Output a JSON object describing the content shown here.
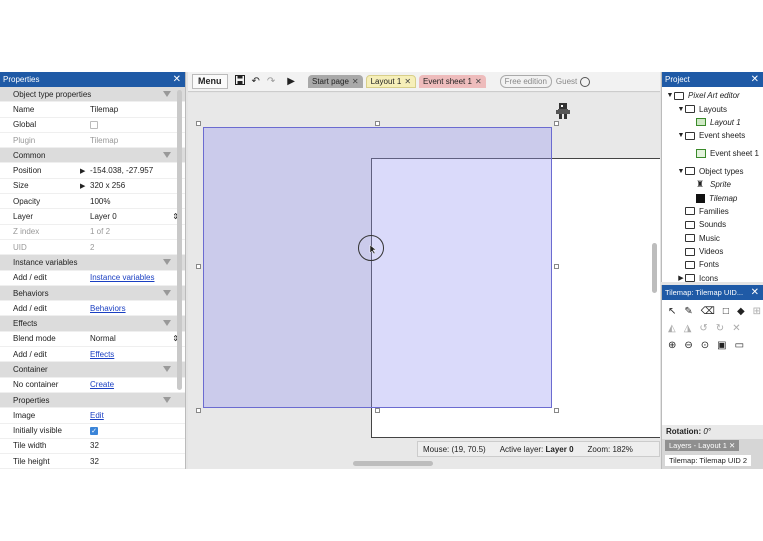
{
  "properties": {
    "title": "Properties",
    "rows": [
      {
        "type": "section",
        "label": "Object type properties"
      },
      {
        "type": "row",
        "key": "Name",
        "value": "Tilemap"
      },
      {
        "type": "check",
        "key": "Global",
        "checked": false
      },
      {
        "type": "row",
        "key": "Plugin",
        "value": "Tilemap",
        "dim": true
      },
      {
        "type": "section",
        "label": "Common"
      },
      {
        "type": "row",
        "key": "Position",
        "value": "-154.038, -27.957",
        "arrow": true
      },
      {
        "type": "row",
        "key": "Size",
        "value": "320 x 256",
        "arrow": true
      },
      {
        "type": "row",
        "key": "Opacity",
        "value": "100%"
      },
      {
        "type": "select",
        "key": "Layer",
        "value": "Layer 0"
      },
      {
        "type": "row",
        "key": "Z index",
        "value": "1 of 2",
        "dim": true
      },
      {
        "type": "row",
        "key": "UID",
        "value": "2",
        "dim": true
      },
      {
        "type": "section",
        "label": "Instance variables"
      },
      {
        "type": "link",
        "key": "Add / edit",
        "value": "Instance variables"
      },
      {
        "type": "section",
        "label": "Behaviors"
      },
      {
        "type": "link",
        "key": "Add / edit",
        "value": "Behaviors"
      },
      {
        "type": "section",
        "label": "Effects"
      },
      {
        "type": "select",
        "key": "Blend mode",
        "value": "Normal"
      },
      {
        "type": "link",
        "key": "Add / edit",
        "value": "Effects"
      },
      {
        "type": "section",
        "label": "Container"
      },
      {
        "type": "link",
        "key": "No container",
        "value": "Create"
      },
      {
        "type": "section",
        "label": "Properties"
      },
      {
        "type": "link",
        "key": "Image",
        "value": "Edit"
      },
      {
        "type": "check",
        "key": "Initially visible",
        "checked": true
      },
      {
        "type": "row",
        "key": "Tile width",
        "value": "32"
      },
      {
        "type": "row",
        "key": "Tile height",
        "value": "32"
      }
    ]
  },
  "toolbar": {
    "menu_label": "Menu",
    "tabs": [
      {
        "label": "Start page",
        "kind": "start"
      },
      {
        "label": "Layout 1",
        "kind": "layout"
      },
      {
        "label": "Event sheet 1",
        "kind": "event"
      }
    ],
    "free_label": "Free edition",
    "guest_label": "Guest"
  },
  "status": {
    "mouse": "Mouse: (19, 70.5)",
    "active_layer_prefix": "Active layer:",
    "active_layer": "Layer 0",
    "zoom": "Zoom: 182%"
  },
  "project": {
    "title": "Project",
    "items": [
      {
        "indent": 0,
        "caret": "▼",
        "icon": "folder",
        "label": "Pixel Art editor",
        "italic": true
      },
      {
        "indent": 1,
        "caret": "▼",
        "icon": "folder",
        "label": "Layouts"
      },
      {
        "indent": 2,
        "caret": "",
        "icon": "layout",
        "label": "Layout 1",
        "italic": true
      },
      {
        "indent": 1,
        "caret": "▼",
        "icon": "folder",
        "label": "Event sheets"
      },
      {
        "indent": 2,
        "caret": "",
        "icon": "sheet",
        "label": "Event sheet 1"
      },
      {
        "indent": 1,
        "caret": "▼",
        "icon": "folder",
        "label": "Object types"
      },
      {
        "indent": 2,
        "caret": "",
        "icon": "sprite",
        "label": "Sprite",
        "italic": true
      },
      {
        "indent": 2,
        "caret": "",
        "icon": "black",
        "label": "Tilemap",
        "italic": true
      },
      {
        "indent": 1,
        "caret": "",
        "icon": "folder",
        "label": "Families"
      },
      {
        "indent": 1,
        "caret": "",
        "icon": "folder",
        "label": "Sounds"
      },
      {
        "indent": 1,
        "caret": "",
        "icon": "folder",
        "label": "Music"
      },
      {
        "indent": 1,
        "caret": "",
        "icon": "folder",
        "label": "Videos"
      },
      {
        "indent": 1,
        "caret": "",
        "icon": "folder",
        "label": "Fonts"
      },
      {
        "indent": 1,
        "caret": "▶",
        "icon": "folder",
        "label": "Icons"
      }
    ]
  },
  "tilemap_panel": {
    "title": "Tilemap: Tilemap UID...",
    "rotation_label": "Rotation:",
    "rotation_value": "0°",
    "bottom_tab_1": "Layers - Layout 1",
    "bottom_tab_2": "Tilemap: Tilemap UID 2"
  }
}
